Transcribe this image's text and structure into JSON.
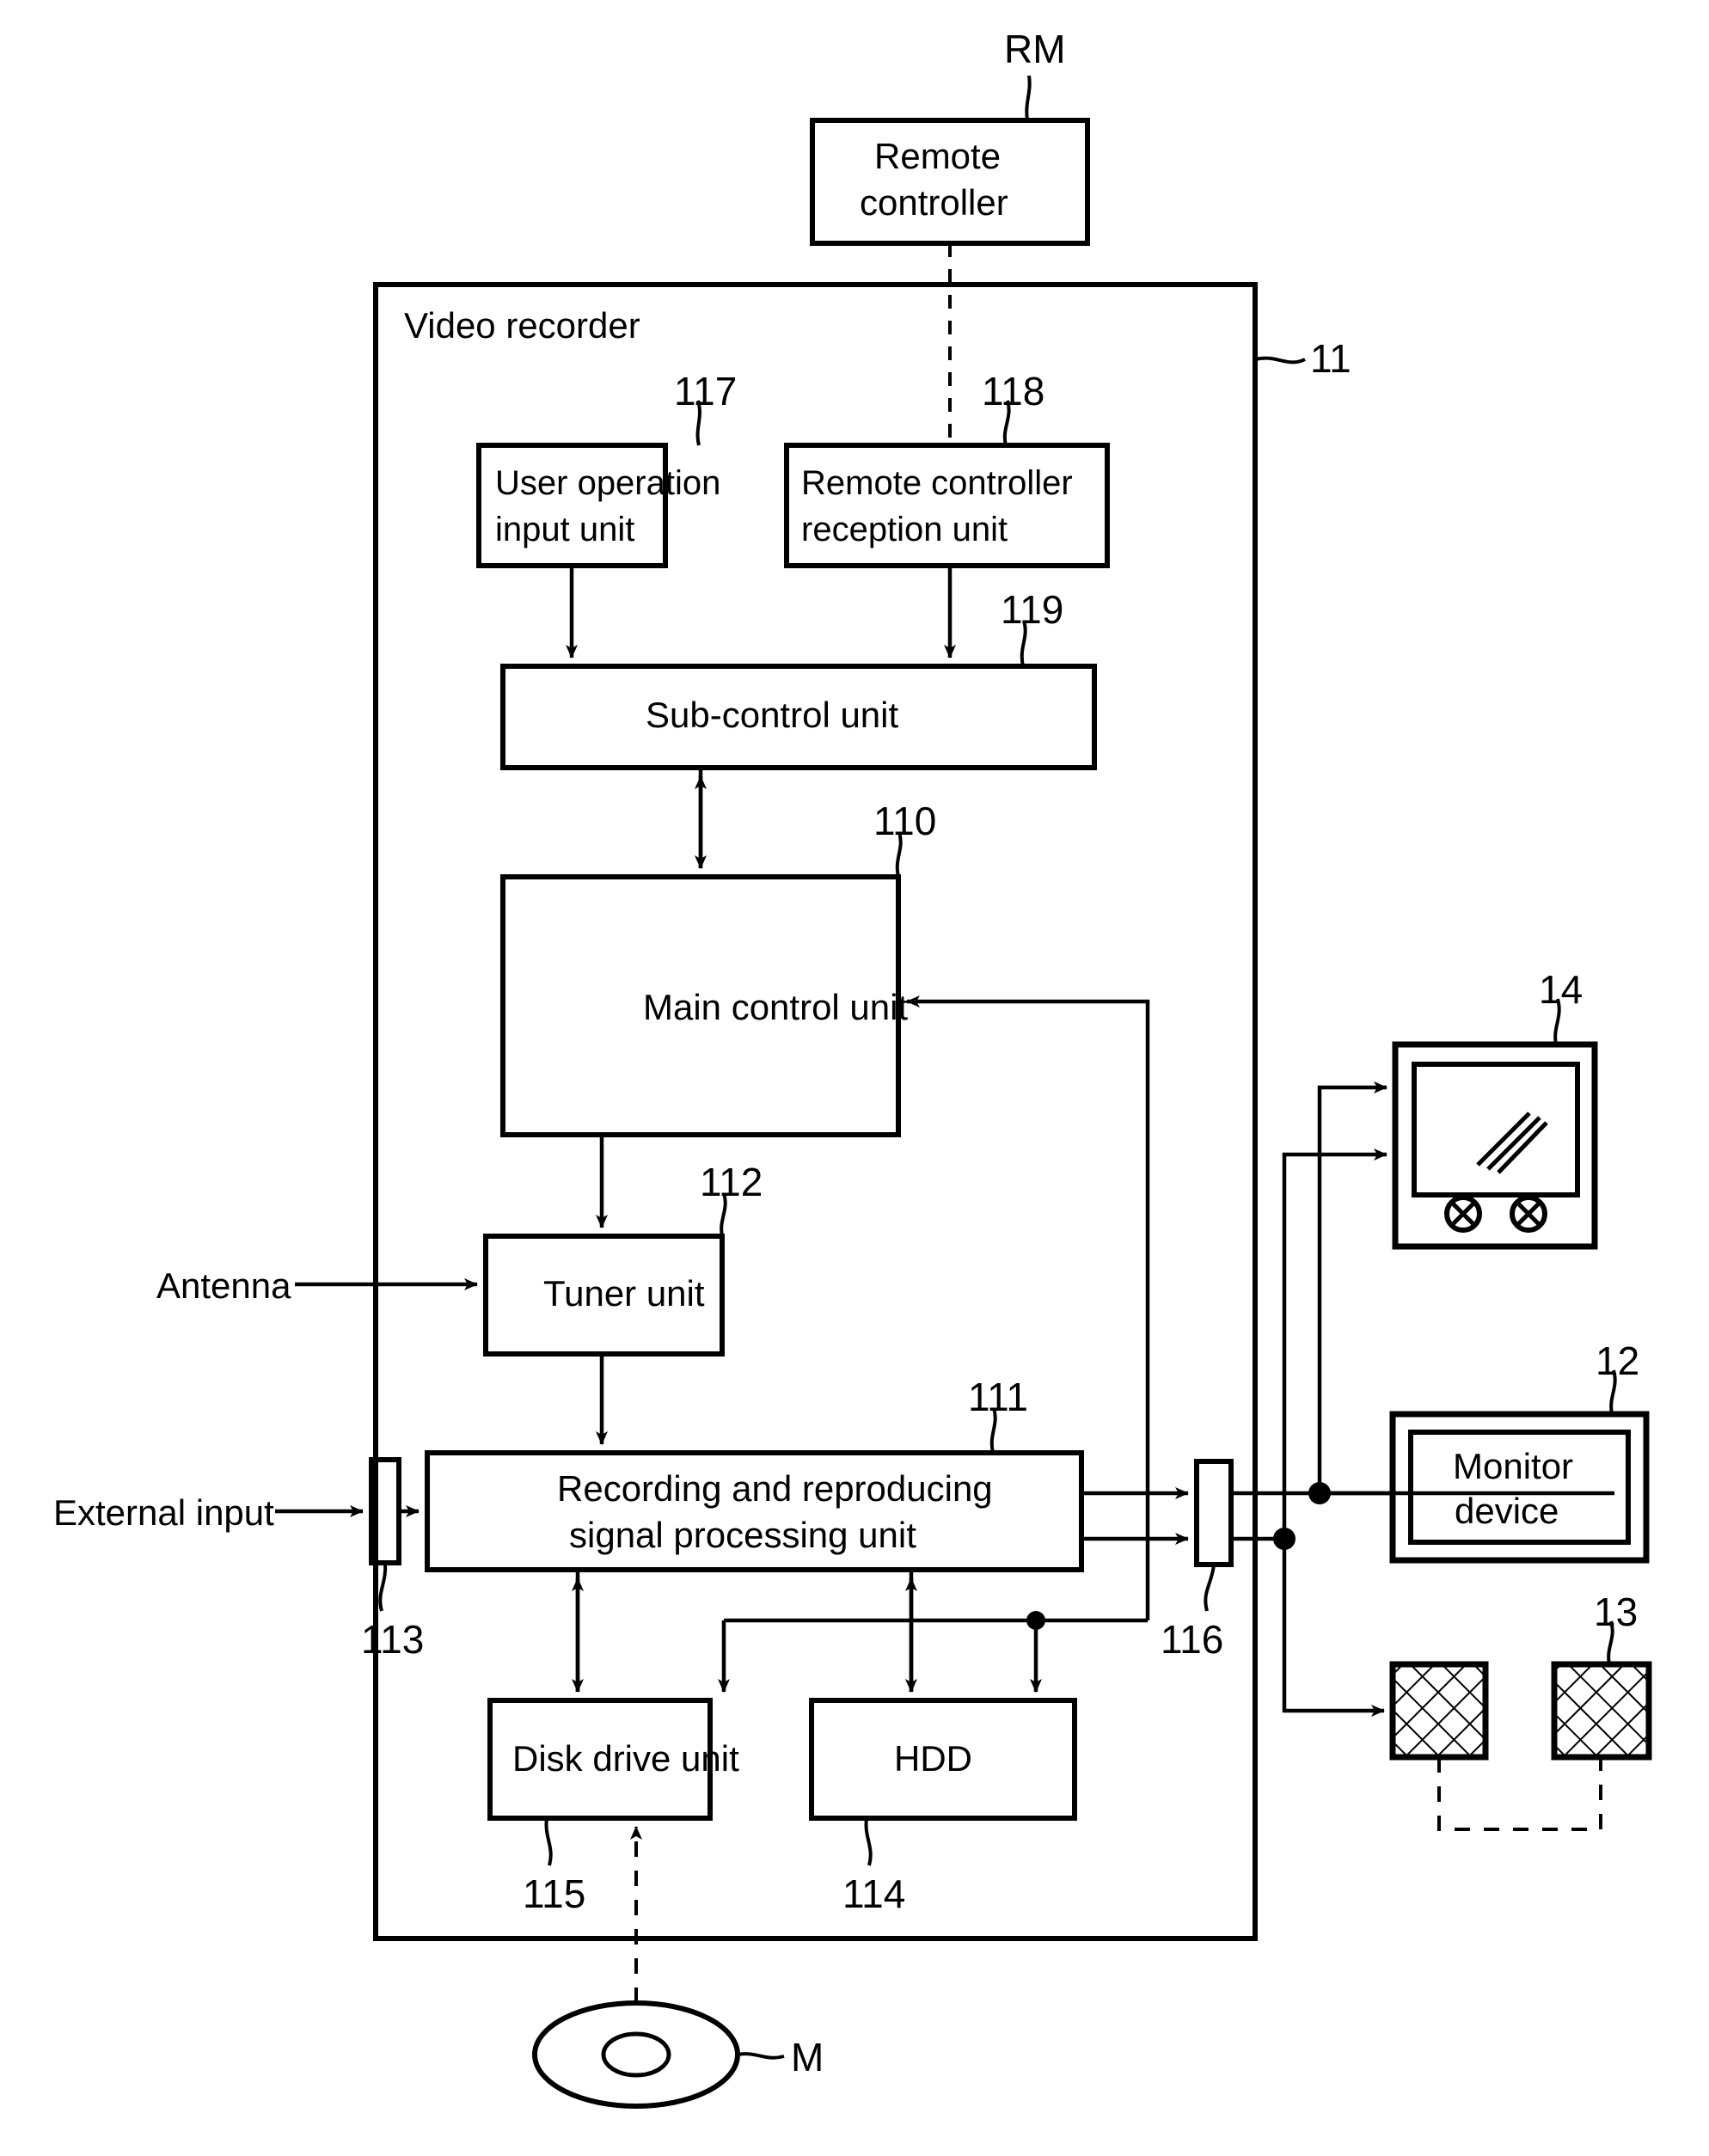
{
  "figure": {
    "type": "block-diagram",
    "title": "Video recorder system block diagram",
    "background": "#ffffff",
    "line_color": "#000000"
  },
  "blocks": {
    "remote_controller": {
      "label_line1": "Remote",
      "label_line2": "controller",
      "ref": "RM"
    },
    "system": {
      "label": "Video recorder",
      "ref": "11"
    },
    "user_operation_input_unit": {
      "label_line1": "User operation",
      "label_line2": "input unit",
      "ref": "117"
    },
    "remote_controller_reception_unit": {
      "label_line1": "Remote controller",
      "label_line2": "reception unit",
      "ref": "118"
    },
    "sub_control_unit": {
      "label": "Sub-control unit",
      "ref": "119"
    },
    "main_control_unit": {
      "label": "Main control unit",
      "ref": "110"
    },
    "tuner_unit": {
      "label": "Tuner unit",
      "ref": "112"
    },
    "external_input_terminal": {
      "label": "",
      "ref": "113"
    },
    "recording_reproducing_unit": {
      "label_line1": "Recording and reproducing",
      "label_line2": "signal processing unit",
      "ref": "111"
    },
    "output_terminal": {
      "label": "",
      "ref": "116"
    },
    "disk_drive_unit": {
      "label": "Disk drive unit",
      "ref": "115"
    },
    "hdd": {
      "label": "HDD",
      "ref": "114"
    },
    "television": {
      "label": "",
      "ref": "14"
    },
    "monitor_device": {
      "label_line1": "Monitor",
      "label_line2": "device",
      "ref": "12"
    },
    "speakers": {
      "label": "",
      "ref": "13"
    },
    "disk_medium": {
      "label": "",
      "ref": "M"
    }
  },
  "signal_labels": {
    "antenna": "Antenna",
    "external_input": "External input"
  },
  "reference_numerals": [
    "RM",
    "11",
    "117",
    "118",
    "119",
    "110",
    "112",
    "113",
    "111",
    "116",
    "115",
    "114",
    "14",
    "12",
    "13",
    "M"
  ]
}
